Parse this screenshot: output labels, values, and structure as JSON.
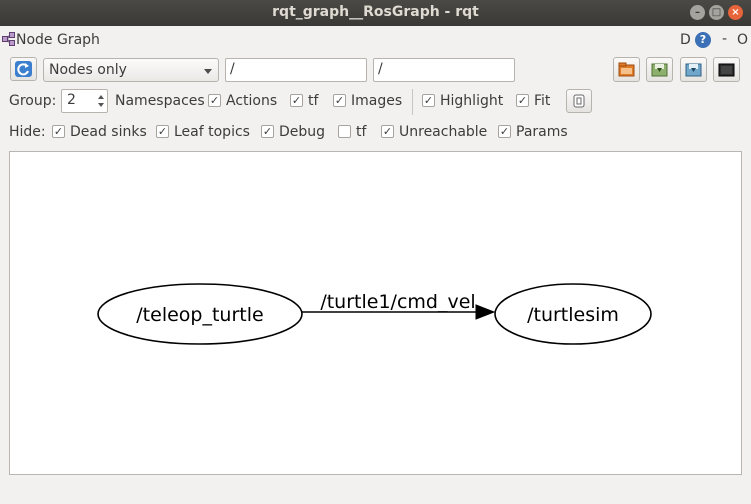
{
  "window": {
    "title": "rqt_graph__RosGraph - rqt"
  },
  "plugin": {
    "title": "Node Graph",
    "d_label": "D",
    "help_glyph": "?",
    "minus_label": "-",
    "o_label": "O"
  },
  "toolbar": {
    "refresh_icon": "refresh-icon",
    "graph_type": "Nodes only",
    "node_filter": "/",
    "topic_filter": "/",
    "buttons": [
      "open-icon",
      "save-dot-icon",
      "save-image-icon",
      "screenshot-icon"
    ]
  },
  "options": {
    "group_label": "Group:",
    "group_value": "2",
    "namespaces_label": "Namespaces",
    "actions_label": "Actions",
    "actions_checked": true,
    "tf_label": "tf",
    "tf_checked": true,
    "images_label": "Images",
    "images_checked": true,
    "highlight_label": "Highlight",
    "highlight_checked": true,
    "fit_label": "Fit",
    "fit_checked": true
  },
  "hide": {
    "label": "Hide:",
    "dead_sinks_label": "Dead sinks",
    "dead_sinks_checked": true,
    "leaf_topics_label": "Leaf topics",
    "leaf_topics_checked": true,
    "debug_label": "Debug",
    "debug_checked": true,
    "tf_label": "tf",
    "tf_checked": false,
    "unreachable_label": "Unreachable",
    "unreachable_checked": true,
    "params_label": "Params",
    "params_checked": true
  },
  "graph": {
    "nodes": [
      "/teleop_turtle",
      "/turtlesim"
    ],
    "edge_topic": "/turtle1/cmd_vel"
  },
  "colors": {
    "titlebar": "#3c3b37",
    "window_bg": "#f2f1f0",
    "close_button": "#e8643a",
    "help_button": "#3b6fb6"
  }
}
